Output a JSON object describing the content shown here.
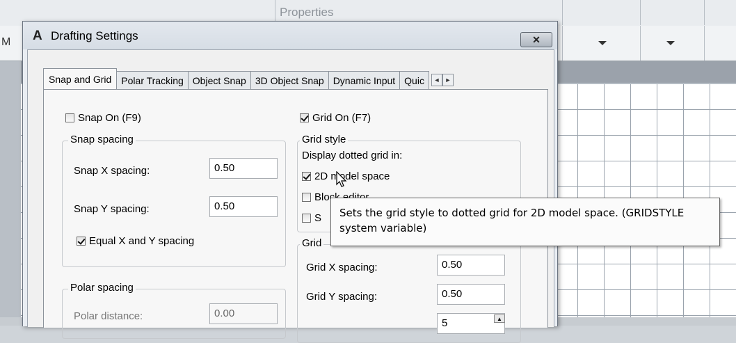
{
  "background": {
    "ribbon_properties_label": "Properties",
    "partial_left_label": "M"
  },
  "dialog": {
    "app_logo": "A",
    "title": "Drafting Settings",
    "close_glyph": "✕",
    "tabs": [
      {
        "label": "Snap and Grid",
        "active": true
      },
      {
        "label": "Polar Tracking",
        "active": false
      },
      {
        "label": "Object Snap",
        "active": false
      },
      {
        "label": "3D Object Snap",
        "active": false
      },
      {
        "label": "Dynamic Input",
        "active": false
      },
      {
        "label": "Quic",
        "active": false
      }
    ],
    "tab_scroll": {
      "left": "◄",
      "right": "►"
    },
    "snap_on": {
      "label": "Snap On (F9)",
      "checked": false
    },
    "grid_on": {
      "label": "Grid On (F7)",
      "checked": true
    },
    "snap_spacing": {
      "group_label": "Snap spacing",
      "x_label": "Snap X spacing:",
      "x_value": "0.50",
      "y_label": "Snap Y spacing:",
      "y_value": "0.50",
      "equal_label": "Equal X and Y spacing",
      "equal_checked": true
    },
    "polar_spacing": {
      "group_label": "Polar spacing",
      "distance_label": "Polar distance:",
      "distance_value": "0.00"
    },
    "grid_style": {
      "group_label": "Grid style",
      "subtitle": "Display dotted grid in:",
      "model_space_label": "2D model space",
      "model_space_checked": true,
      "block_editor_label": "Block editor",
      "block_editor_checked": false,
      "sheet_label": "S",
      "sheet_checked": false
    },
    "grid_spacing": {
      "group_label": "Grid",
      "x_label": "Grid X spacing:",
      "x_value": "0.50",
      "y_label": "Grid Y spacing:",
      "y_value": "0.50",
      "major_value": "5"
    }
  },
  "tooltip": {
    "line1": "Sets the grid style to dotted grid for 2D model space. (GRIDSTYLE",
    "line2": "system variable)"
  }
}
